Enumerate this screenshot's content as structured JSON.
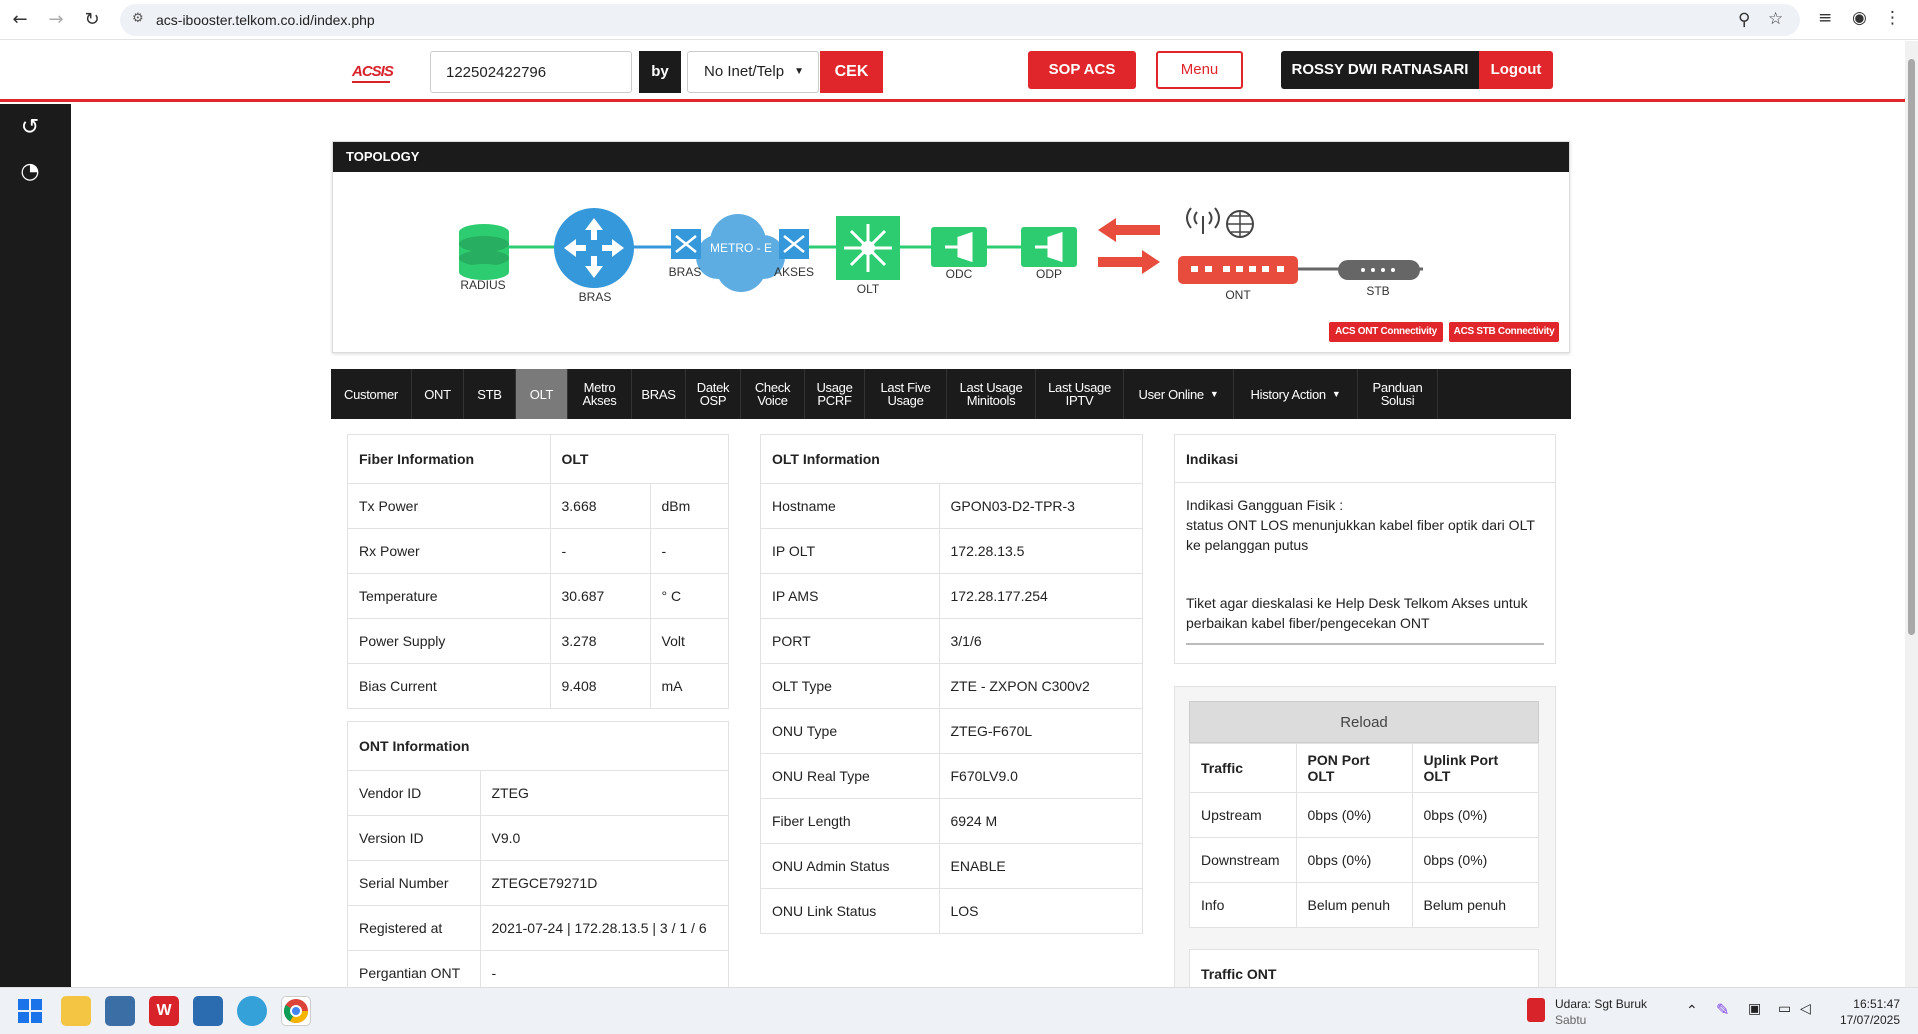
{
  "browser": {
    "url": "acs-ibooster.telkom.co.id/index.php"
  },
  "header": {
    "logo": "ACSIS",
    "search_value": "122502422796",
    "by_label": "by",
    "select_value": "No Inet/Telp",
    "cek_label": "CEK",
    "sop_label": "SOP ACS",
    "menu_label": "Menu",
    "user_name": "ROSSY DWI RATNASARI",
    "logout_label": "Logout"
  },
  "sidebar": {
    "items": [
      {
        "icon": "undo-icon"
      },
      {
        "icon": "dashboard-icon"
      }
    ]
  },
  "topology": {
    "title": "TOPOLOGY",
    "nodes": {
      "radius": "RADIUS",
      "bras": "BRAS",
      "bras_small": "BRAS",
      "metro": "METRO - E",
      "akses": "AKSES",
      "olt": "OLT",
      "odc": "ODC",
      "odp": "ODP",
      "ont": "ONT",
      "stb": "STB"
    },
    "btn_ont": "ACS ONT Connectivity",
    "btn_stb": "ACS STB Connectivity"
  },
  "tabs": [
    {
      "label": "Customer"
    },
    {
      "label": "ONT"
    },
    {
      "label": "STB"
    },
    {
      "label": "OLT",
      "active": true
    },
    {
      "label": "Metro\nAkses"
    },
    {
      "label": "BRAS"
    },
    {
      "label": "Datek\nOSP"
    },
    {
      "label": "Check\nVoice"
    },
    {
      "label": "Usage\nPCRF"
    },
    {
      "label": "Last Five\nUsage"
    },
    {
      "label": "Last Usage\nMinitools"
    },
    {
      "label": "Last Usage\nIPTV"
    },
    {
      "label": "User Online",
      "dropdown": true
    },
    {
      "label": "History Action",
      "dropdown": true
    },
    {
      "label": "Panduan\nSolusi"
    }
  ],
  "fiber": {
    "h1": "Fiber Information",
    "h2": "OLT",
    "rows": [
      {
        "k": "Tx Power",
        "v": "3.668",
        "u": "dBm"
      },
      {
        "k": "Rx Power",
        "v": "-",
        "u": "-"
      },
      {
        "k": "Temperature",
        "v": "30.687",
        "u": "° C"
      },
      {
        "k": "Power Supply",
        "v": "3.278",
        "u": "Volt"
      },
      {
        "k": "Bias Current",
        "v": "9.408",
        "u": "mA"
      }
    ]
  },
  "ont": {
    "title": "ONT Information",
    "rows": [
      {
        "k": "Vendor ID",
        "v": "ZTEG"
      },
      {
        "k": "Version ID",
        "v": "V9.0"
      },
      {
        "k": "Serial Number",
        "v": "ZTEGCE79271D"
      },
      {
        "k": "Registered at",
        "v": "2021-07-24 | 172.28.13.5 | 3 / 1 / 6"
      },
      {
        "k": "Pergantian ONT",
        "v": "-"
      }
    ]
  },
  "olt": {
    "title": "OLT Information",
    "rows": [
      {
        "k": "Hostname",
        "v": "GPON03-D2-TPR-3"
      },
      {
        "k": "IP OLT",
        "v": "172.28.13.5"
      },
      {
        "k": "IP AMS",
        "v": "172.28.177.254"
      },
      {
        "k": "PORT",
        "v": "3/1/6"
      },
      {
        "k": "OLT Type",
        "v": "ZTE - ZXPON C300v2"
      },
      {
        "k": "ONU Type",
        "v": "ZTEG-F670L"
      },
      {
        "k": "ONU Real Type",
        "v": "F670LV9.0"
      },
      {
        "k": "Fiber Length",
        "v": "6924 M"
      },
      {
        "k": "ONU Admin Status",
        "v": "ENABLE"
      },
      {
        "k": "ONU Link Status",
        "v": "LOS"
      }
    ]
  },
  "indikasi": {
    "title": "Indikasi",
    "line1": "Indikasi Gangguan Fisik :",
    "line2": "status ONT LOS menunjukkan kabel fiber optik dari OLT ke pelanggan putus",
    "line3": "Tiket agar dieskalasi ke Help Desk Telkom Akses untuk perbaikan kabel fiber/pengecekan ONT"
  },
  "traffic": {
    "reload": "Reload",
    "headers": [
      "Traffic",
      "PON Port OLT",
      "Uplink Port OLT"
    ],
    "rows": [
      [
        "Upstream",
        "0bps (0%)",
        "0bps (0%)"
      ],
      [
        "Downstream",
        "0bps (0%)",
        "0bps (0%)"
      ],
      [
        "Info",
        "Belum penuh",
        "Belum penuh"
      ]
    ],
    "traffic_ont": "Traffic ONT"
  },
  "taskbar": {
    "weather_title": "Udara: Sgt Buruk",
    "weather_sub": "Sabtu",
    "time": "16:51:47",
    "date": "17/07/2025"
  },
  "colors": {
    "brand_red": "#e0262b",
    "dark": "#1b1b1b",
    "node_green": "#2ecc71",
    "node_blue": "#3498db"
  }
}
